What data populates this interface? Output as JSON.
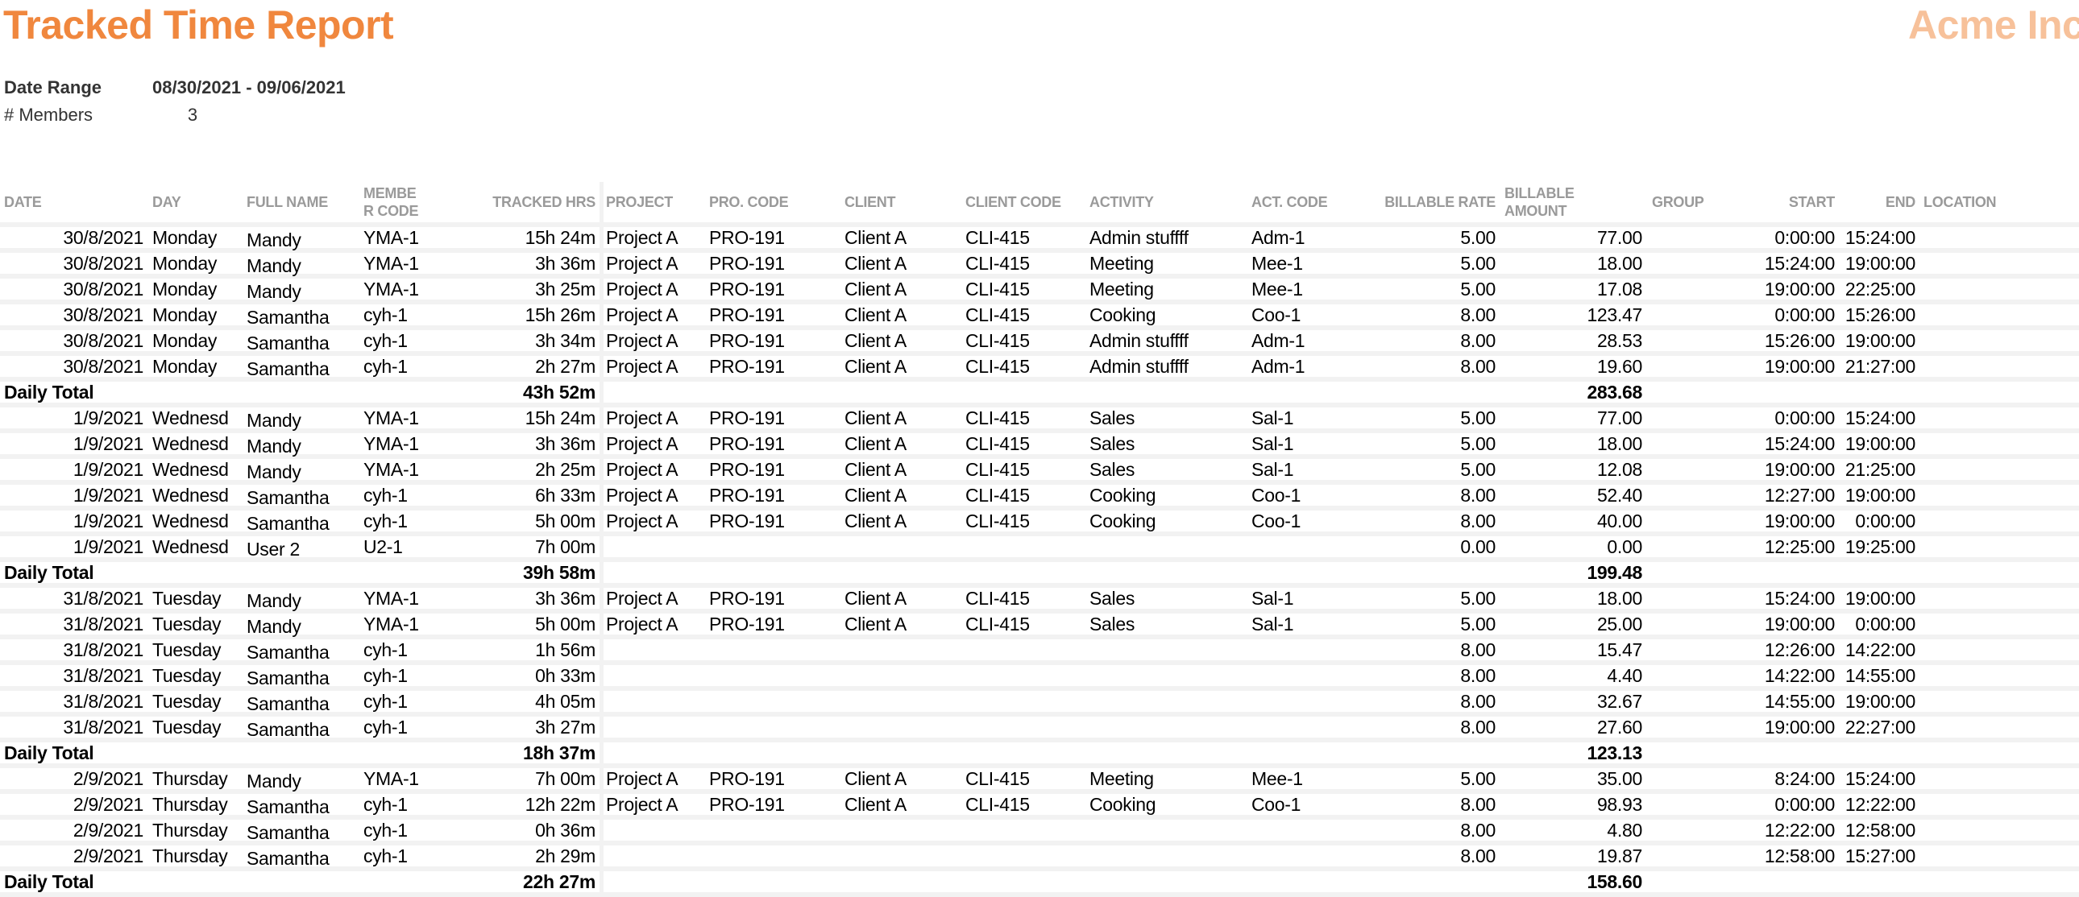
{
  "header": {
    "title": "Tracked Time Report",
    "company": "Acme Inc",
    "colors": {
      "title": "#f0873e",
      "company": "#f7c19a"
    }
  },
  "meta": {
    "date_range_label": "Date Range",
    "date_range_value": "08/30/2021 - 09/06/2021",
    "members_label": "# Members",
    "members_value": "3"
  },
  "table": {
    "columns": {
      "date": "DATE",
      "day": "DAY",
      "full_name": "FULL NAME",
      "member_code": "MEMBE\nR CODE",
      "tracked_hrs": "TRACKED HRS",
      "project": "PROJECT",
      "pro_code": "PRO. CODE",
      "client": "CLIENT",
      "client_code": "CLIENT CODE",
      "activity": "ACTIVITY",
      "act_code": "ACT. CODE",
      "billable_rate": "BILLABLE RATE",
      "billable_amount": "BILLABLE\nAMOUNT",
      "group": "GROUP",
      "start": "START",
      "end": "END",
      "location": "LOCATION"
    },
    "daily_total_label": "Daily Total",
    "groups": [
      {
        "rows": [
          {
            "date": "30/8/2021",
            "day": "Monday",
            "name": "Mandy",
            "mcode": "YMA-1",
            "hrs": "15h 24m",
            "project": "Project A",
            "pcode": "PRO-191",
            "client": "Client A",
            "ccode": "CLI-415",
            "activity": "Admin stuffff",
            "acode": "Adm-1",
            "rate": "5.00",
            "amount": "77.00",
            "group": "",
            "start": "0:00:00",
            "end": "15:24:00",
            "location": ""
          },
          {
            "date": "30/8/2021",
            "day": "Monday",
            "name": "Mandy",
            "mcode": "YMA-1",
            "hrs": "3h 36m",
            "project": "Project A",
            "pcode": "PRO-191",
            "client": "Client A",
            "ccode": "CLI-415",
            "activity": "Meeting",
            "acode": "Mee-1",
            "rate": "5.00",
            "amount": "18.00",
            "group": "",
            "start": "15:24:00",
            "end": "19:00:00",
            "location": ""
          },
          {
            "date": "30/8/2021",
            "day": "Monday",
            "name": "Mandy",
            "mcode": "YMA-1",
            "hrs": "3h 25m",
            "project": "Project A",
            "pcode": "PRO-191",
            "client": "Client A",
            "ccode": "CLI-415",
            "activity": "Meeting",
            "acode": "Mee-1",
            "rate": "5.00",
            "amount": "17.08",
            "group": "",
            "start": "19:00:00",
            "end": "22:25:00",
            "location": ""
          },
          {
            "date": "30/8/2021",
            "day": "Monday",
            "name": "Samantha",
            "mcode": "cyh-1",
            "hrs": "15h 26m",
            "project": "Project A",
            "pcode": "PRO-191",
            "client": "Client A",
            "ccode": "CLI-415",
            "activity": "Cooking",
            "acode": "Coo-1",
            "rate": "8.00",
            "amount": "123.47",
            "group": "",
            "start": "0:00:00",
            "end": "15:26:00",
            "location": ""
          },
          {
            "date": "30/8/2021",
            "day": "Monday",
            "name": "Samantha",
            "mcode": "cyh-1",
            "hrs": "3h 34m",
            "project": "Project A",
            "pcode": "PRO-191",
            "client": "Client A",
            "ccode": "CLI-415",
            "activity": "Admin stuffff",
            "acode": "Adm-1",
            "rate": "8.00",
            "amount": "28.53",
            "group": "",
            "start": "15:26:00",
            "end": "19:00:00",
            "location": ""
          },
          {
            "date": "30/8/2021",
            "day": "Monday",
            "name": "Samantha",
            "mcode": "cyh-1",
            "hrs": "2h 27m",
            "project": "Project A",
            "pcode": "PRO-191",
            "client": "Client A",
            "ccode": "CLI-415",
            "activity": "Admin stuffff",
            "acode": "Adm-1",
            "rate": "8.00",
            "amount": "19.60",
            "group": "",
            "start": "19:00:00",
            "end": "21:27:00",
            "location": ""
          }
        ],
        "total_hrs": "43h 52m",
        "total_amount": "283.68"
      },
      {
        "rows": [
          {
            "date": "1/9/2021",
            "day": "Wednesd",
            "name": "Mandy",
            "mcode": "YMA-1",
            "hrs": "15h 24m",
            "project": "Project A",
            "pcode": "PRO-191",
            "client": "Client A",
            "ccode": "CLI-415",
            "activity": "Sales",
            "acode": "Sal-1",
            "rate": "5.00",
            "amount": "77.00",
            "group": "",
            "start": "0:00:00",
            "end": "15:24:00",
            "location": ""
          },
          {
            "date": "1/9/2021",
            "day": "Wednesd",
            "name": "Mandy",
            "mcode": "YMA-1",
            "hrs": "3h 36m",
            "project": "Project A",
            "pcode": "PRO-191",
            "client": "Client A",
            "ccode": "CLI-415",
            "activity": "Sales",
            "acode": "Sal-1",
            "rate": "5.00",
            "amount": "18.00",
            "group": "",
            "start": "15:24:00",
            "end": "19:00:00",
            "location": ""
          },
          {
            "date": "1/9/2021",
            "day": "Wednesd",
            "name": "Mandy",
            "mcode": "YMA-1",
            "hrs": "2h 25m",
            "project": "Project A",
            "pcode": "PRO-191",
            "client": "Client A",
            "ccode": "CLI-415",
            "activity": "Sales",
            "acode": "Sal-1",
            "rate": "5.00",
            "amount": "12.08",
            "group": "",
            "start": "19:00:00",
            "end": "21:25:00",
            "location": ""
          },
          {
            "date": "1/9/2021",
            "day": "Wednesd",
            "name": "Samantha",
            "mcode": "cyh-1",
            "hrs": "6h 33m",
            "project": "Project A",
            "pcode": "PRO-191",
            "client": "Client A",
            "ccode": "CLI-415",
            "activity": "Cooking",
            "acode": "Coo-1",
            "rate": "8.00",
            "amount": "52.40",
            "group": "",
            "start": "12:27:00",
            "end": "19:00:00",
            "location": ""
          },
          {
            "date": "1/9/2021",
            "day": "Wednesd",
            "name": "Samantha",
            "mcode": "cyh-1",
            "hrs": "5h 00m",
            "project": "Project A",
            "pcode": "PRO-191",
            "client": "Client A",
            "ccode": "CLI-415",
            "activity": "Cooking",
            "acode": "Coo-1",
            "rate": "8.00",
            "amount": "40.00",
            "group": "",
            "start": "19:00:00",
            "end": "0:00:00",
            "location": ""
          },
          {
            "date": "1/9/2021",
            "day": "Wednesd",
            "name": "User 2",
            "mcode": "U2-1",
            "hrs": "7h 00m",
            "project": "",
            "pcode": "",
            "client": "",
            "ccode": "",
            "activity": "",
            "acode": "",
            "rate": "0.00",
            "amount": "0.00",
            "group": "",
            "start": "12:25:00",
            "end": "19:25:00",
            "location": ""
          }
        ],
        "total_hrs": "39h 58m",
        "total_amount": "199.48"
      },
      {
        "rows": [
          {
            "date": "31/8/2021",
            "day": "Tuesday",
            "name": "Mandy",
            "mcode": "YMA-1",
            "hrs": "3h 36m",
            "project": "Project A",
            "pcode": "PRO-191",
            "client": "Client A",
            "ccode": "CLI-415",
            "activity": "Sales",
            "acode": "Sal-1",
            "rate": "5.00",
            "amount": "18.00",
            "group": "",
            "start": "15:24:00",
            "end": "19:00:00",
            "location": ""
          },
          {
            "date": "31/8/2021",
            "day": "Tuesday",
            "name": "Mandy",
            "mcode": "YMA-1",
            "hrs": "5h 00m",
            "project": "Project A",
            "pcode": "PRO-191",
            "client": "Client A",
            "ccode": "CLI-415",
            "activity": "Sales",
            "acode": "Sal-1",
            "rate": "5.00",
            "amount": "25.00",
            "group": "",
            "start": "19:00:00",
            "end": "0:00:00",
            "location": ""
          },
          {
            "date": "31/8/2021",
            "day": "Tuesday",
            "name": "Samantha",
            "mcode": "cyh-1",
            "hrs": "1h 56m",
            "project": "",
            "pcode": "",
            "client": "",
            "ccode": "",
            "activity": "",
            "acode": "",
            "rate": "8.00",
            "amount": "15.47",
            "group": "",
            "start": "12:26:00",
            "end": "14:22:00",
            "location": ""
          },
          {
            "date": "31/8/2021",
            "day": "Tuesday",
            "name": "Samantha",
            "mcode": "cyh-1",
            "hrs": "0h 33m",
            "project": "",
            "pcode": "",
            "client": "",
            "ccode": "",
            "activity": "",
            "acode": "",
            "rate": "8.00",
            "amount": "4.40",
            "group": "",
            "start": "14:22:00",
            "end": "14:55:00",
            "location": ""
          },
          {
            "date": "31/8/2021",
            "day": "Tuesday",
            "name": "Samantha",
            "mcode": "cyh-1",
            "hrs": "4h 05m",
            "project": "",
            "pcode": "",
            "client": "",
            "ccode": "",
            "activity": "",
            "acode": "",
            "rate": "8.00",
            "amount": "32.67",
            "group": "",
            "start": "14:55:00",
            "end": "19:00:00",
            "location": ""
          },
          {
            "date": "31/8/2021",
            "day": "Tuesday",
            "name": "Samantha",
            "mcode": "cyh-1",
            "hrs": "3h 27m",
            "project": "",
            "pcode": "",
            "client": "",
            "ccode": "",
            "activity": "",
            "acode": "",
            "rate": "8.00",
            "amount": "27.60",
            "group": "",
            "start": "19:00:00",
            "end": "22:27:00",
            "location": ""
          }
        ],
        "total_hrs": "18h 37m",
        "total_amount": "123.13"
      },
      {
        "rows": [
          {
            "date": "2/9/2021",
            "day": "Thursday",
            "name": "Mandy",
            "mcode": "YMA-1",
            "hrs": "7h 00m",
            "project": "Project A",
            "pcode": "PRO-191",
            "client": "Client A",
            "ccode": "CLI-415",
            "activity": "Meeting",
            "acode": "Mee-1",
            "rate": "5.00",
            "amount": "35.00",
            "group": "",
            "start": "8:24:00",
            "end": "15:24:00",
            "location": ""
          },
          {
            "date": "2/9/2021",
            "day": "Thursday",
            "name": "Samantha",
            "mcode": "cyh-1",
            "hrs": "12h 22m",
            "project": "Project A",
            "pcode": "PRO-191",
            "client": "Client A",
            "ccode": "CLI-415",
            "activity": "Cooking",
            "acode": "Coo-1",
            "rate": "8.00",
            "amount": "98.93",
            "group": "",
            "start": "0:00:00",
            "end": "12:22:00",
            "location": ""
          },
          {
            "date": "2/9/2021",
            "day": "Thursday",
            "name": "Samantha",
            "mcode": "cyh-1",
            "hrs": "0h 36m",
            "project": "",
            "pcode": "",
            "client": "",
            "ccode": "",
            "activity": "",
            "acode": "",
            "rate": "8.00",
            "amount": "4.80",
            "group": "",
            "start": "12:22:00",
            "end": "12:58:00",
            "location": ""
          },
          {
            "date": "2/9/2021",
            "day": "Thursday",
            "name": "Samantha",
            "mcode": "cyh-1",
            "hrs": "2h 29m",
            "project": "",
            "pcode": "",
            "client": "",
            "ccode": "",
            "activity": "",
            "acode": "",
            "rate": "8.00",
            "amount": "19.87",
            "group": "",
            "start": "12:58:00",
            "end": "15:27:00",
            "location": ""
          }
        ],
        "total_hrs": "22h 27m",
        "total_amount": "158.60"
      }
    ]
  }
}
